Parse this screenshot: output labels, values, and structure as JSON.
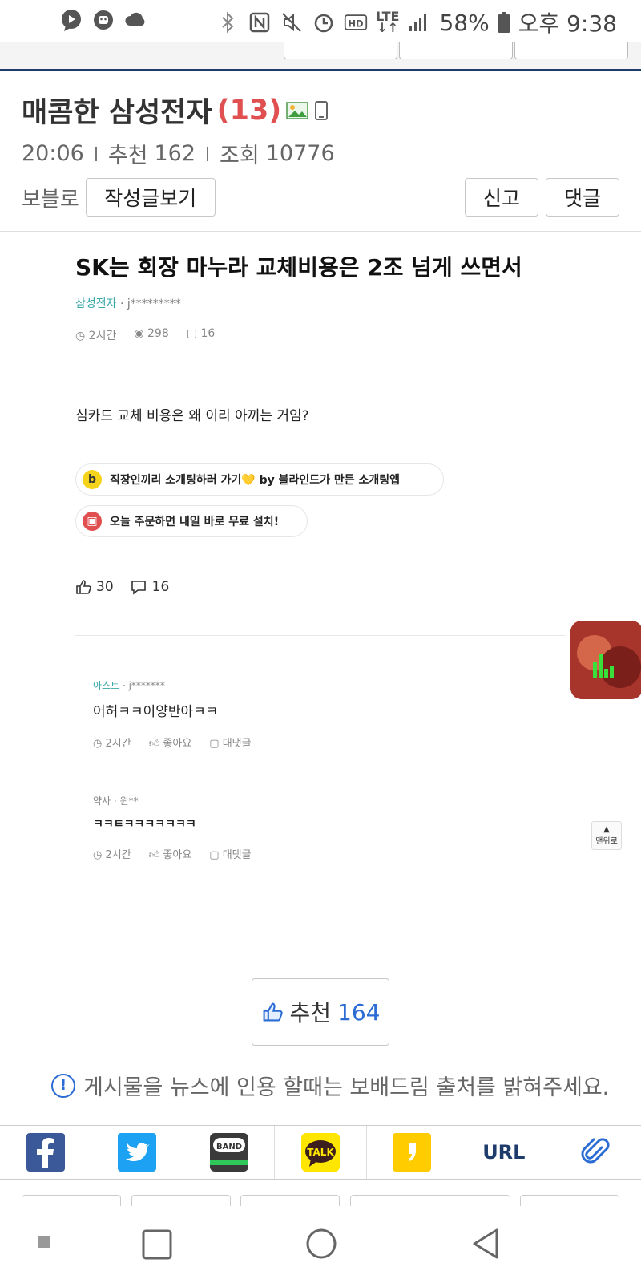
{
  "status_bar": {
    "battery": "58%",
    "time": "오후 9:38",
    "network": "LTE",
    "icons": [
      "messenger-icon",
      "android-debug-icon",
      "cloud-icon",
      "bluetooth-icon",
      "nfc-icon",
      "mute-icon",
      "alarm-icon",
      "hd-icon",
      "lte-icon",
      "signal-icon",
      "battery-icon"
    ]
  },
  "post": {
    "title": "매콤한 삼성전자",
    "comment_count": "(13)",
    "icons": [
      "image-attached-icon",
      "mobile-icon"
    ],
    "time": "20:06",
    "recommend_label": "추천",
    "recommend_count": "162",
    "views_label": "조회",
    "views_count": "10776",
    "author": "보블로",
    "btn_view_posts": "작성글보기",
    "btn_report": "신고",
    "btn_comment": "댓글"
  },
  "article": {
    "title": "SK는 회장 마누라 교체비용은 2조 넘게 쓰면서",
    "company": "삼성전자",
    "author_sep": " · ",
    "author": "j*********",
    "time": "2시간",
    "views": "298",
    "comments": "16",
    "body": "심카드 교체 비용은 왜 이리 아끼는 거임?",
    "ad1": "직장인끼리 소개팅하러 가기💛 by 블라인드가 만든 소개팅앱",
    "ad1_badge": "b",
    "ad2": "오늘 주문하면 내일 바로 무료 설치!",
    "likes": "30",
    "reply_count": "16",
    "comments_list": [
      {
        "company": "아스트",
        "author": "j*******",
        "text": "어허ㅋㅋ이양반아ㅋㅋ",
        "time": "2시간",
        "like_label": "좋아요",
        "reply_label": "대댓글"
      },
      {
        "company": "약사",
        "author": "윈**",
        "text": "ㅋㅋㅌㅋㅋㅋㅋㅋㅋㅋ",
        "time": "2시간",
        "like_label": "좋아요",
        "reply_label": "대댓글"
      }
    ]
  },
  "floating": {
    "top_label": "맨위로",
    "top_arrow": "▲"
  },
  "recommend": {
    "label": "추천",
    "count": "164"
  },
  "notice": {
    "icon": "!",
    "text": "게시물을 뉴스에 인용 할때는 보배드림 출처를 밝혀주세요."
  },
  "share": {
    "items": [
      "facebook",
      "twitter",
      "band",
      "kakaotalk",
      "kakaostory",
      "url",
      "attach"
    ],
    "band_label": "BAND",
    "talk_label": "TALK",
    "url_label": "URL"
  },
  "colors": {
    "accent_red": "#e05050",
    "accent_blue": "#2b6cd4",
    "teal": "#3aa7a7",
    "navy": "#1d3b6b"
  }
}
